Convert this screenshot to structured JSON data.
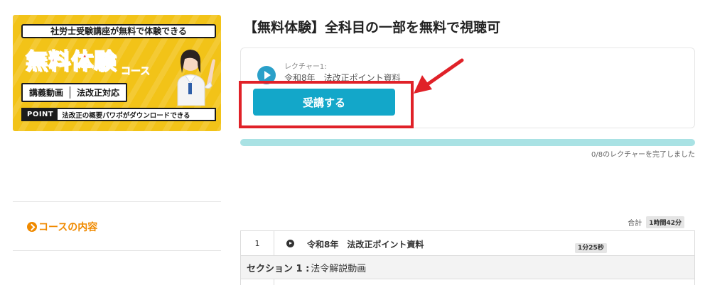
{
  "banner": {
    "top": "社労士受験講座が無料で体験できる",
    "main": "無料体験",
    "sub": "コース",
    "tag1": "講義動画",
    "tag2": "法改正対応",
    "point_label": "POINT",
    "point_text": "法改正の概要パワポがダウンロードできる"
  },
  "course": {
    "title": "【無料体験】全科目の一部を無料で視聴可"
  },
  "lecture_card": {
    "label": "レクチャー1:",
    "name": "令和8年　法改正ポイント資料",
    "enroll_label": "受講する"
  },
  "progress": {
    "text": "0/8のレクチャーを完了しました",
    "completed": 0,
    "total": 8
  },
  "sidebar": {
    "item": "コースの内容"
  },
  "curriculum": {
    "total_label": "合計",
    "total_time": "1時間42分",
    "rows": [
      {
        "num": "1",
        "title": "令和8年　法改正ポイント資料",
        "duration": "1分25秒"
      }
    ],
    "section": {
      "label": "セクション 1 :",
      "name": "法令解説動画"
    }
  },
  "colors": {
    "accent": "#13a7c9",
    "progress_track": "#a9e2e4",
    "sidebar_accent": "#f08a00",
    "annotation": "#e02128",
    "banner_bg": "#f2c318"
  }
}
